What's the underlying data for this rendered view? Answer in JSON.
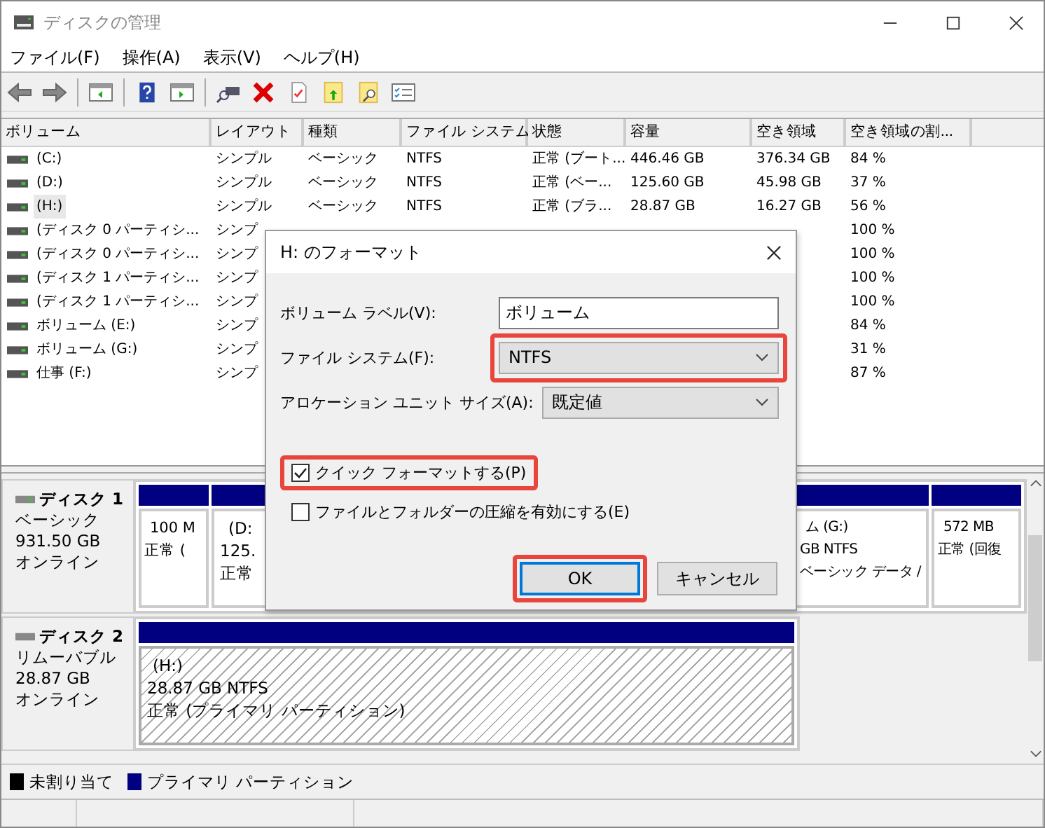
{
  "window": {
    "title": "ディスクの管理"
  },
  "menu": [
    "ファイル(F)",
    "操作(A)",
    "表示(V)",
    "ヘルプ(H)"
  ],
  "table": {
    "columns": [
      "ボリューム",
      "レイアウト",
      "種類",
      "ファイル システム",
      "状態",
      "容量",
      "空き領域",
      "空き領域の割..."
    ],
    "rows": [
      {
        "cells": [
          "(C:)",
          "シンプル",
          "ベーシック",
          "NTFS",
          "正常 (ブート...",
          "446.46 GB",
          "376.34 GB",
          "84 %"
        ],
        "selected": false
      },
      {
        "cells": [
          "(D:)",
          "シンプル",
          "ベーシック",
          "NTFS",
          "正常 (ベー...",
          "125.60 GB",
          "45.98 GB",
          "37 %"
        ],
        "selected": false
      },
      {
        "cells": [
          "(H:)",
          "シンプル",
          "ベーシック",
          "NTFS",
          "正常 (ブラ...",
          "28.87 GB",
          "16.27 GB",
          "56 %"
        ],
        "selected": true
      },
      {
        "cells": [
          "(ディスク 0 パーティシ...",
          "シンプ",
          null,
          null,
          null,
          null,
          null,
          "100 %"
        ],
        "selected": false
      },
      {
        "cells": [
          "(ディスク 0 パーティシ...",
          "シンプ",
          null,
          null,
          null,
          null,
          null,
          "100 %"
        ],
        "selected": false
      },
      {
        "cells": [
          "(ディスク 1 パーティシ...",
          "シンプ",
          null,
          null,
          null,
          null,
          null,
          "100 %"
        ],
        "selected": false
      },
      {
        "cells": [
          "(ディスク 1 パーティシ...",
          "シンプ",
          null,
          null,
          null,
          null,
          null,
          "100 %"
        ],
        "selected": false
      },
      {
        "cells": [
          "ボリューム (E:)",
          "シンプ",
          null,
          null,
          null,
          null,
          null,
          "84 %"
        ],
        "selected": false
      },
      {
        "cells": [
          "ボリューム (G:)",
          "シンプ",
          null,
          null,
          null,
          null,
          null,
          "31 %"
        ],
        "selected": false
      },
      {
        "cells": [
          "仕事 (F:)",
          "シンプ",
          null,
          null,
          null,
          null,
          null,
          "87 %"
        ],
        "selected": false
      }
    ]
  },
  "disks": [
    {
      "name": "ディスク 1",
      "lines": [
        "ベーシック",
        "931.50 GB",
        "オンライン"
      ],
      "partitions": [
        {
          "lines": [
            "100 M",
            "正常 ("
          ],
          "selected": false
        },
        {
          "lines": [
            "(D:",
            "125.",
            "正常"
          ],
          "selected": false
        },
        {
          "lines": [
            "ム (G:)",
            "GB NTFS",
            "ベーシック データ /"
          ],
          "selected": false
        },
        {
          "lines": [
            "572 MB",
            "正常 (回復"
          ],
          "selected": false
        }
      ]
    },
    {
      "name": "ディスク 2",
      "lines": [
        "リムーバブル",
        "28.87 GB",
        "オンライン"
      ],
      "partitions": [
        {
          "lines": [
            "(H:)",
            "28.87 GB NTFS",
            "正常 (プライマリ パーティション)"
          ],
          "selected": true
        }
      ]
    }
  ],
  "legend": [
    {
      "label": "未割り当て",
      "color": "#000000"
    },
    {
      "label": "プライマリ パーティション",
      "color": "#000080"
    }
  ],
  "dialog": {
    "title": "H: のフォーマット",
    "fields": [
      {
        "kind": "input",
        "label": "ボリューム ラベル(V):",
        "value": "ボリューム",
        "highlighted": false
      },
      {
        "kind": "select",
        "label": "ファイル システム(F):",
        "value": "NTFS",
        "highlighted": true
      },
      {
        "kind": "select",
        "label": "アロケーション ユニット サイズ(A):",
        "value": "既定値",
        "highlighted": false
      }
    ],
    "checkboxes": [
      {
        "label": "クイック フォーマットする(P)",
        "checked": true,
        "highlighted": true
      },
      {
        "label": "ファイルとフォルダーの圧縮を有効にする(E)",
        "checked": false,
        "highlighted": false
      }
    ],
    "buttons": [
      {
        "label": "OK",
        "kind": "default",
        "highlighted": true
      },
      {
        "label": "キャンセル",
        "kind": "normal",
        "highlighted": false
      }
    ]
  }
}
